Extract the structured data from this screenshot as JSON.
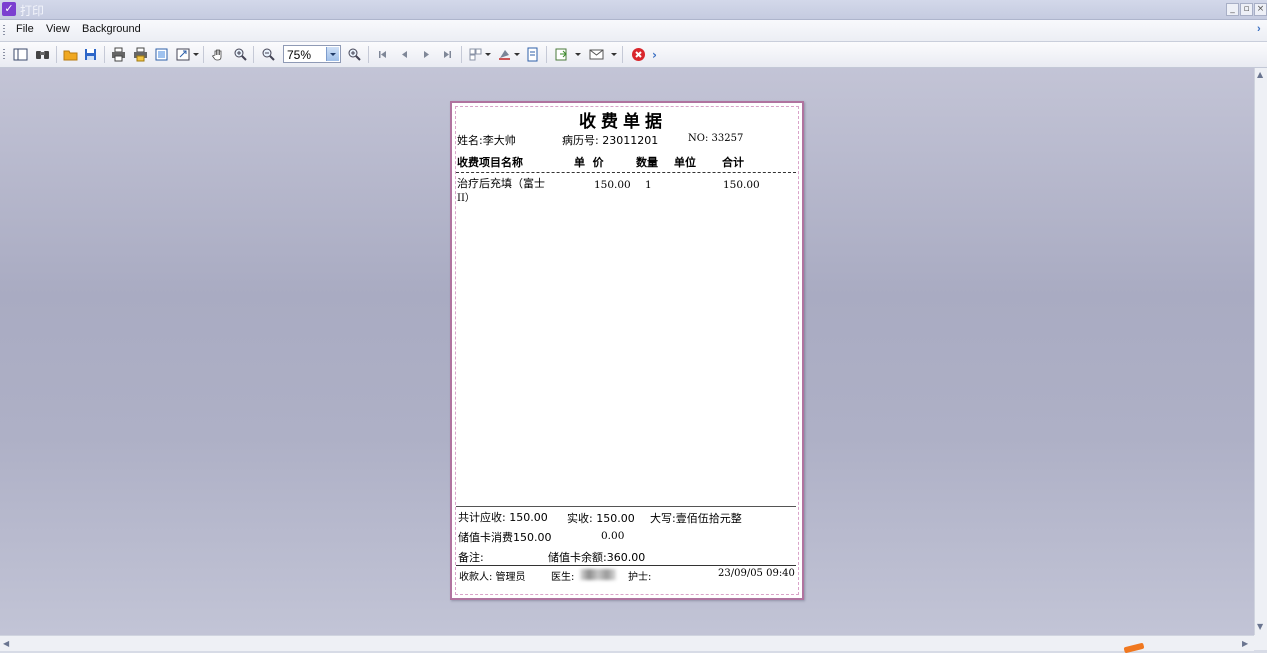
{
  "window": {
    "title": "打印",
    "minimize_label": "_",
    "maximize_label": "▫",
    "close_label": "×"
  },
  "menu": {
    "items": [
      "File",
      "View",
      "Background"
    ]
  },
  "toolbar": {
    "zoom": "75%",
    "icons": [
      "toggle-panel-icon",
      "find-icon",
      "open-icon",
      "save-icon",
      "print-icon",
      "quick-print-icon",
      "page-setup-icon",
      "scale-icon",
      "hand-tool-icon",
      "magnifier-icon",
      "zoom-out-icon",
      "zoom-in-icon",
      "first-page-icon",
      "previous-page-icon",
      "next-page-icon",
      "last-page-icon",
      "multiple-pages-icon",
      "color-icon",
      "watermark-icon",
      "export-icon",
      "email-icon",
      "close-preview-icon"
    ]
  },
  "receipt": {
    "title": "收费单据",
    "name": "姓名:李大帅",
    "record_no": "病历号: 23011201",
    "no": "NO: 33257",
    "columns": [
      "收费项目名称",
      "单  价",
      "数量",
      "单位",
      "合计"
    ],
    "rows": [
      {
        "item_line1": "治疗后充填（富士",
        "item_line2": "II）",
        "price": "150.00",
        "qty": "1",
        "unit": "",
        "total": "150.00"
      }
    ],
    "total_due": "共计应收: 150.00",
    "paid": "实收: 150.00",
    "in_words": "大写:壹佰伍拾元整",
    "card_spend": "储值卡消费150.00",
    "card_other": "0.00",
    "remark": "备注:",
    "card_balance": "储值卡余额:360.00",
    "cashier": "收款人: 管理员",
    "doctor": "医生:",
    "nurse": "护士:",
    "datetime": "23/09/05 09:40"
  },
  "scroll": {
    "up": "▲",
    "down": "▼",
    "left": "◀",
    "right": "▶",
    "menu_overflow": "›",
    "toolbar_overflow": "›"
  }
}
